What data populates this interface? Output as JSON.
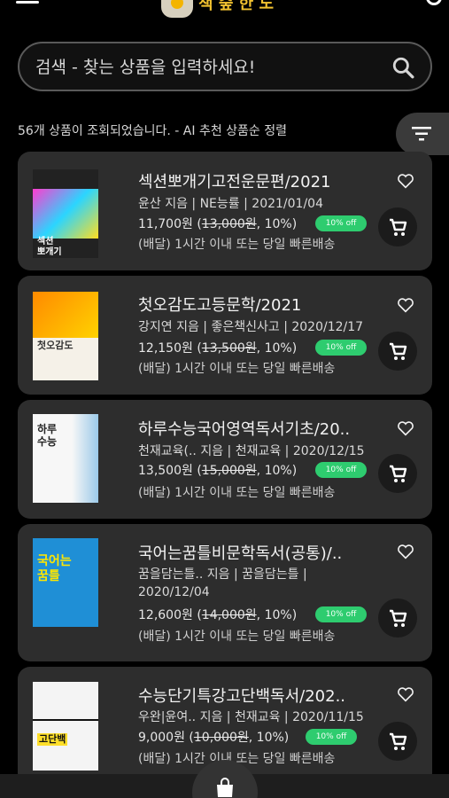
{
  "header": {
    "logo_text": "책 숲 한 도"
  },
  "search": {
    "placeholder": "검색 - 찾는 상품을 입력하세요!"
  },
  "results": {
    "summary": "56개 상품이 조회되었습니다. - AI 추천 상품순 정렬"
  },
  "products": [
    {
      "title": "섹션뽀개기고전운문편/2021",
      "meta": "윤산 지음 | NE능률 | 2021/01/04",
      "meta2": "",
      "price": "11,700원",
      "original_price": "13,000원",
      "discount": "10%",
      "badge": "10% off",
      "delivery": "(배달) 1시간 이내 또는 당일 빠른배송",
      "cover_text": "섹션\n뽀개기",
      "cover_color": "#222222"
    },
    {
      "title": "첫오감도고등문학/2021",
      "meta": "강지연 지음 | 좋은책신사고 | 2020/12/17",
      "meta2": "",
      "price": "12,150원",
      "original_price": "13,500원",
      "discount": "10%",
      "badge": "10% off",
      "delivery": "(배달) 1시간 이내 또는 당일 빠른배송",
      "cover_text": "첫오감도",
      "cover_color": "#f6a040"
    },
    {
      "title": "하루수능국어영역독서기초/20..",
      "meta": "천재교육(.. 지음 | 천재교육 | 2020/12/15",
      "meta2": "",
      "price": "13,500원",
      "original_price": "15,000원",
      "discount": "10%",
      "badge": "10% off",
      "delivery": "(배달) 1시간 이내 또는 당일 빠른배송",
      "cover_text": "하루\n수능",
      "cover_color": "#9bc9e8"
    },
    {
      "title": "국어는꿈틀비문학독서(공통)/..",
      "meta": "꿈을담는틀.. 지음 | 꿈을담는틀 |",
      "meta2": "2020/12/04",
      "price": "12,600원",
      "original_price": "14,000원",
      "discount": "10%",
      "badge": "10% off",
      "delivery": "(배달) 1시간 이내 또는 당일 빠른배송",
      "cover_text": "국어는\n꿈틀",
      "cover_color": "#1f8fd6"
    },
    {
      "title": "수능단기특강고단백독서/202..",
      "meta": "우완|윤여.. 지음 | 천재교육 | 2020/11/15",
      "meta2": "",
      "price": "9,000원",
      "original_price": "10,000원",
      "discount": "10%",
      "badge": "10% off",
      "delivery": "(배달) 1시간 이내 또는 당일 빠른배송",
      "cover_text": "고단백",
      "cover_color": "#f3f3f3"
    }
  ],
  "colors": {
    "accent": "#2ecc6f",
    "card": "#2d2d2d",
    "background": "#000000"
  }
}
